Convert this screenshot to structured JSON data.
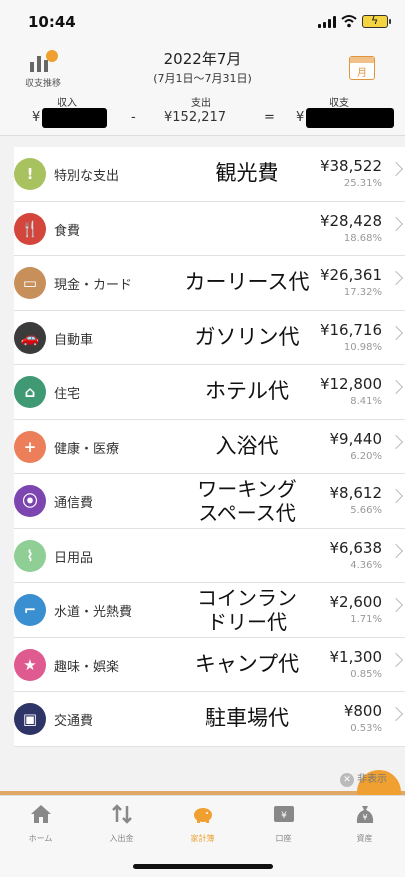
{
  "status_bar": {
    "time": "10:44"
  },
  "header": {
    "trend_label": "収支推移",
    "title": "2022年7月",
    "subtitle": "(7月1日〜7月31日)",
    "calendar_glyph": "月"
  },
  "summary": {
    "income_label": "収入",
    "expense_label": "支出",
    "balance_label": "収支",
    "currency": "¥",
    "expense_value": "¥152,217",
    "minus": "-",
    "equals": "="
  },
  "rows": [
    {
      "icon": "exclamation-icon",
      "glyph": "!",
      "color": "#a7c25e",
      "category": "特別な支出",
      "note": "観光費",
      "amount": "¥38,522",
      "percent": "25.31%"
    },
    {
      "icon": "fork-knife-icon",
      "glyph": "🍴",
      "color": "#d4453c",
      "category": "食費",
      "note": "",
      "amount": "¥28,428",
      "percent": "18.68%"
    },
    {
      "icon": "wallet-icon",
      "glyph": "▭",
      "color": "#c78f5a",
      "category": "現金・カード",
      "note": "カーリース代",
      "amount": "¥26,361",
      "percent": "17.32%"
    },
    {
      "icon": "car-icon",
      "glyph": "🚗",
      "color": "#3b3b3b",
      "category": "自動車",
      "note": "ガソリン代",
      "amount": "¥16,716",
      "percent": "10.98%"
    },
    {
      "icon": "house-icon",
      "glyph": "⌂",
      "color": "#3f9a74",
      "category": "住宅",
      "note": "ホテル代",
      "amount": "¥12,800",
      "percent": "8.41%"
    },
    {
      "icon": "plus-icon",
      "glyph": "+",
      "color": "#ec7f5a",
      "category": "健康・医療",
      "note": "入浴代",
      "amount": "¥9,440",
      "percent": "6.20%"
    },
    {
      "icon": "antenna-icon",
      "glyph": "⦿",
      "color": "#7d45b0",
      "category": "通信費",
      "note": "ワーキング\nスペース代",
      "amount": "¥8,612",
      "percent": "5.66%"
    },
    {
      "icon": "toothbrush-icon",
      "glyph": "⌇",
      "color": "#8fcf95",
      "category": "日用品",
      "note": "",
      "amount": "¥6,638",
      "percent": "4.36%"
    },
    {
      "icon": "faucet-icon",
      "glyph": "⌐",
      "color": "#3a8fd1",
      "category": "水道・光熱費",
      "note": "コインラン\nドリー代",
      "amount": "¥2,600",
      "percent": "1.71%"
    },
    {
      "icon": "star-icon",
      "glyph": "★",
      "color": "#df5a8e",
      "category": "趣味・娯楽",
      "note": "キャンプ代",
      "amount": "¥1,300",
      "percent": "0.85%"
    },
    {
      "icon": "train-icon",
      "glyph": "▣",
      "color": "#2e3566",
      "category": "交通費",
      "note": "駐車場代",
      "amount": "¥800",
      "percent": "0.53%"
    }
  ],
  "hide_label": "非表示",
  "tabs": [
    {
      "icon": "home-icon",
      "label": "ホーム"
    },
    {
      "icon": "transfer-icon",
      "label": "入出金"
    },
    {
      "icon": "piggy-bank-icon",
      "label": "家計簿"
    },
    {
      "icon": "account-icon",
      "label": "口座"
    },
    {
      "icon": "money-bag-icon",
      "label": "資産"
    }
  ],
  "active_tab_index": 2,
  "colors": {
    "accent": "#f0a030"
  }
}
